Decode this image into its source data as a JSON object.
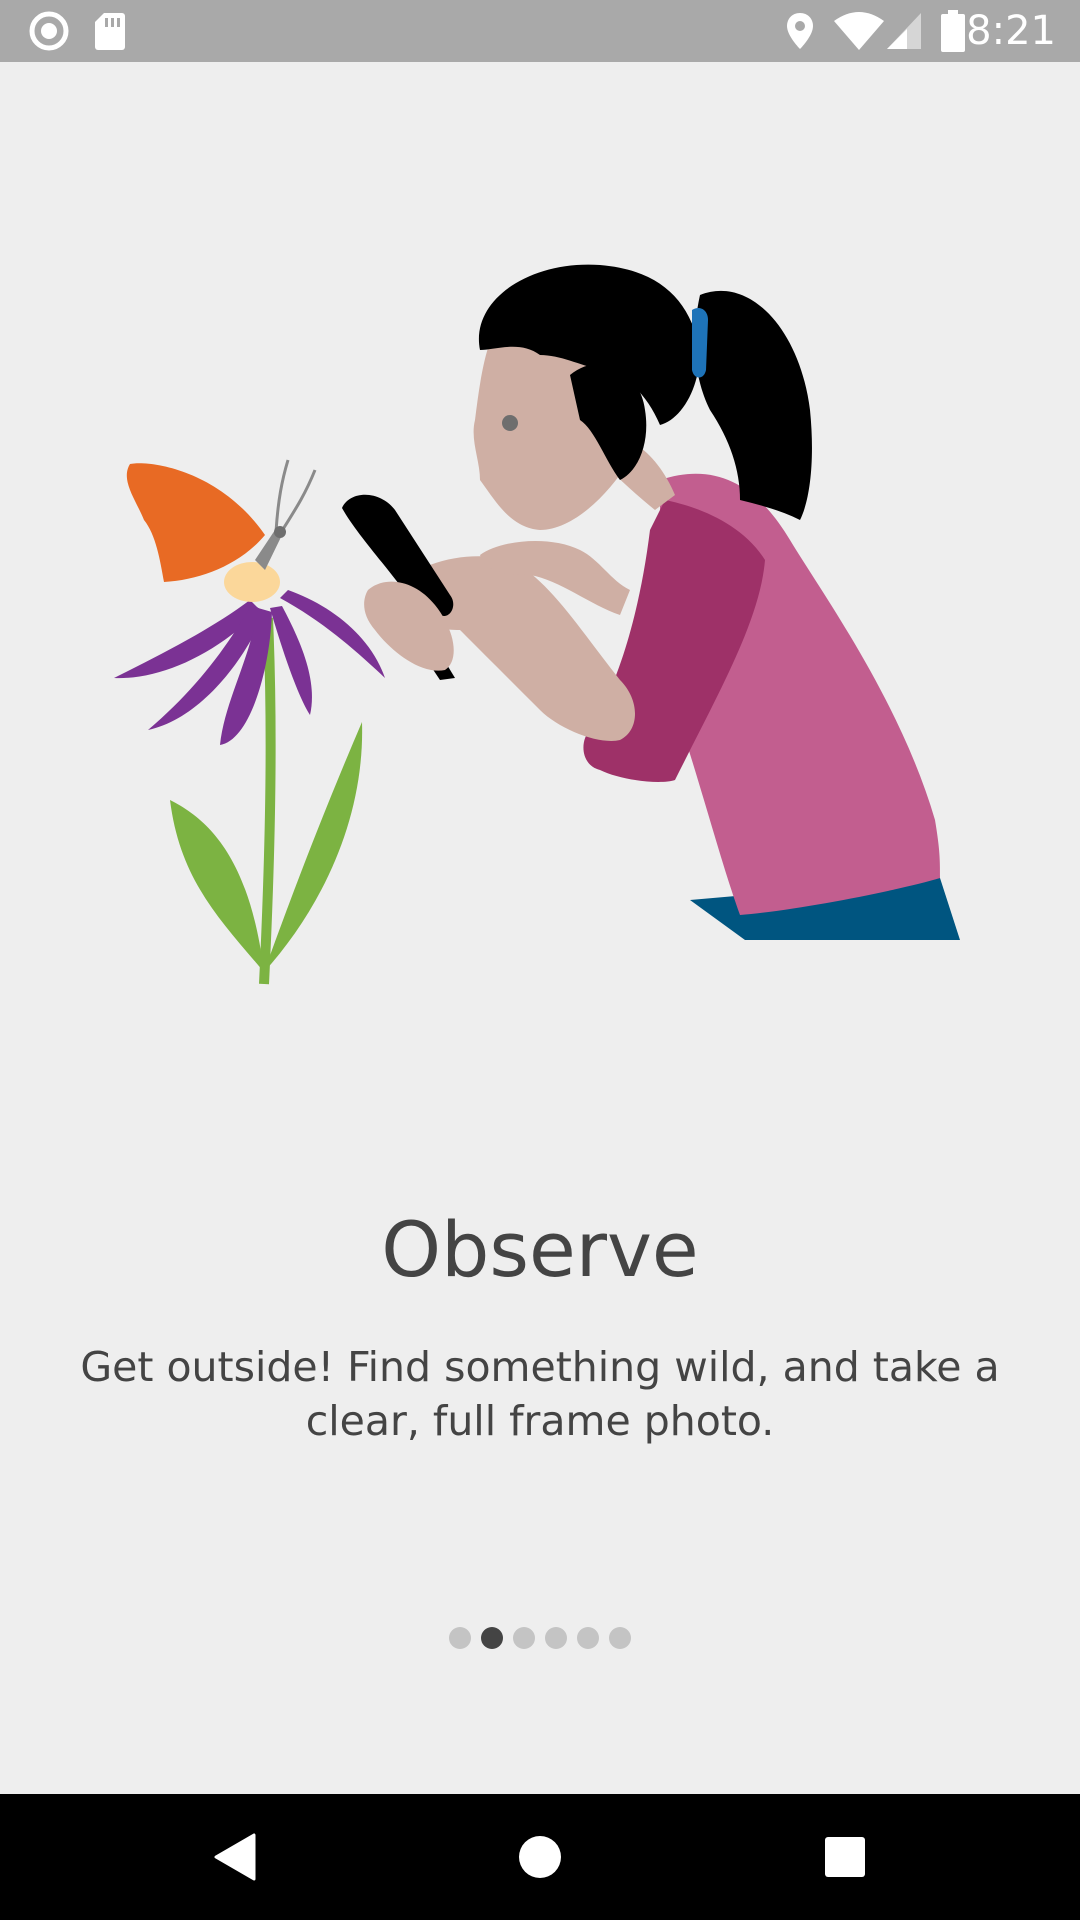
{
  "status_bar": {
    "time": "8:21",
    "left_icons": [
      "record-icon",
      "sd-card-icon"
    ],
    "right_icons": [
      "location-icon",
      "wifi-icon",
      "signal-icon",
      "battery-icon"
    ]
  },
  "onboarding": {
    "title": "Observe",
    "description": "Get outside! Find something wild, and take a clear, full frame photo.",
    "page_indicator": {
      "total": 6,
      "current": 2
    }
  },
  "nav_bar": {
    "buttons": [
      "back-icon",
      "home-icon",
      "recents-icon"
    ]
  },
  "colors": {
    "background": "#eeeeee",
    "status_bar": "#a9a9a9",
    "text": "#444444",
    "dot_inactive": "#c4c4c4",
    "dot_active": "#444444"
  }
}
